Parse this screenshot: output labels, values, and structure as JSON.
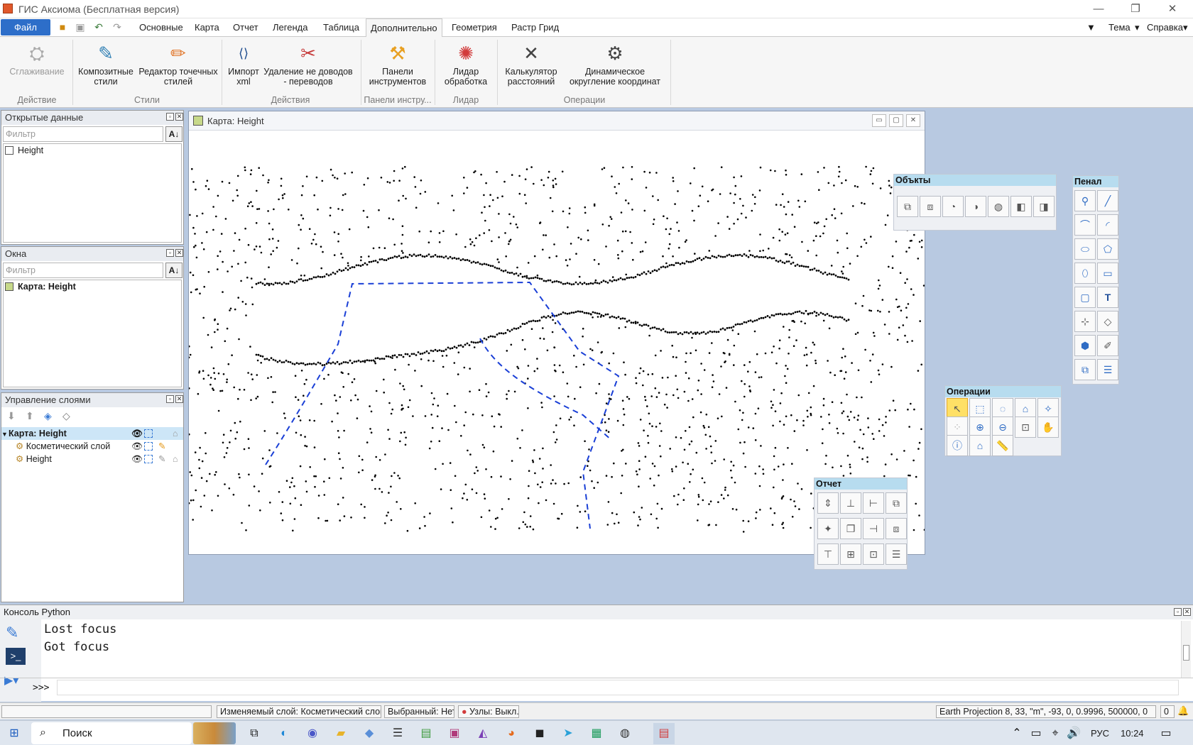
{
  "window": {
    "title": "ГИС Аксиома (Бесплатная версия)",
    "minimize": "—",
    "restore": "❐",
    "close": "✕"
  },
  "menu": {
    "file": "Файл",
    "tabs": [
      "Основные",
      "Карта",
      "Отчет",
      "Легенда",
      "Таблица",
      "Дополнительно",
      "Геометрия",
      "Растр Грид"
    ],
    "active": "Дополнительно",
    "right": {
      "arrow": "▼",
      "theme": "Тема",
      "help": "Справка",
      "caret": "▾"
    }
  },
  "ribbon": {
    "buttons": [
      {
        "label1": "Сглаживание",
        "label2": "",
        "icon": "smoothing-icon",
        "glyph": "⛭",
        "disabled": true
      },
      {
        "label1": "Композитные",
        "label2": "стили",
        "icon": "composite-styles-icon",
        "glyph": "✎"
      },
      {
        "label1": "Редактор точечных",
        "label2": "стилей",
        "icon": "point-style-editor-icon",
        "glyph": "✏"
      },
      {
        "label1": "Импорт",
        "label2": "xml",
        "icon": "import-xml-icon",
        "glyph": "⟨⟩"
      },
      {
        "label1": "Удаление не доводов",
        "label2": "- переводов",
        "icon": "remove-undershoots-icon",
        "glyph": "✂"
      },
      {
        "label1": "Панели",
        "label2": "инструментов",
        "icon": "toolbars-icon",
        "glyph": "⚒"
      },
      {
        "label1": "Лидар",
        "label2": "обработка",
        "icon": "lidar-icon",
        "glyph": "✺"
      },
      {
        "label1": "Калькулятор",
        "label2": "расстояний",
        "icon": "distance-calculator-icon",
        "glyph": "✕"
      },
      {
        "label1": "Динамическое",
        "label2": "округление координат",
        "icon": "dynamic-rounding-icon",
        "glyph": "⚙"
      }
    ],
    "groups": [
      "Действие",
      "Стили",
      "Действия",
      "Панели инстру...",
      "Лидар",
      "Операции"
    ]
  },
  "open_data": {
    "title": "Открытые данные",
    "filter_placeholder": "Фильтр",
    "sort": "A↓",
    "items": [
      "Height"
    ]
  },
  "windows_panel": {
    "title": "Окна",
    "filter_placeholder": "Фильтр",
    "sort": "A↓",
    "items": [
      "Карта: Height"
    ]
  },
  "layers": {
    "title": "Управление слоями",
    "map": "Карта: Height",
    "rows": [
      "Косметический слой",
      "Height"
    ]
  },
  "map": {
    "title": "Карта: Height"
  },
  "toolboxes": {
    "objects": "Объкты",
    "penal": "Пенал",
    "operations": "Операции",
    "report": "Отчет"
  },
  "console": {
    "title": "Консоль Python",
    "lines": [
      "Lost focus",
      "Got focus"
    ],
    "prompt": ">>>"
  },
  "status": {
    "editable": "Изменяемый слой: Косметический слой",
    "selected": "Выбранный: Нет",
    "nodes": "Узлы: Выкл.",
    "projection": "Earth Projection 8, 33, \"m\", -93, 0, 0.9996, 500000, 0",
    "count": "0"
  },
  "taskbar": {
    "search": "Поиск",
    "lang": "РУС",
    "time": "10:24"
  }
}
